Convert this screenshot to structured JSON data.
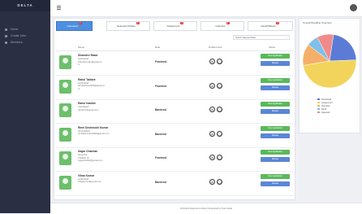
{
  "app": {
    "brand": "DELTA"
  },
  "sidebar": {
    "items": [
      {
        "label": "Home"
      },
      {
        "label": "Create Jobs"
      },
      {
        "label": "Members"
      }
    ]
  },
  "tabs": [
    {
      "label": "Interested",
      "badge": "7"
    },
    {
      "label": "Selected Profiles",
      "badge": "4"
    },
    {
      "label": "Assignment",
      "badge": "3"
    },
    {
      "label": "Interview",
      "badge": "6"
    },
    {
      "label": "Hired/Offered",
      "badge": "2"
    }
  ],
  "filter": {
    "placeholder": "Search Selected Roles"
  },
  "table": {
    "headers": [
      "Name",
      "Role",
      "Profile Links",
      "Action"
    ],
    "rows": [
      {
        "name": "Shamdev Rawa",
        "lines": [
          "Hyderabad",
          "shamdevr.dev@gmail.co",
          "m"
        ],
        "role": "Frontend"
      },
      {
        "name": "Rahul Tathare",
        "lines": [
          "Hyderabad",
          "rahultathare2009@gmail.co",
          "m"
        ],
        "role": "Frontend"
      },
      {
        "name": "Rahul Kamble",
        "lines": [
          "Chandigarh",
          "rahulk17@gmail.com"
        ],
        "role": "Backend"
      },
      {
        "name": "Rinni Deshmukh Kumar",
        "lines": [
          "Ahmedabad",
          "rinnideshmukh2000@gmail.com"
        ],
        "role": "Backend"
      },
      {
        "name": "Sagar Chauhan",
        "lines": [
          "Himachal",
          "Pradesh 10",
          "sagarch2022@gmail.com"
        ],
        "role": "Frontend"
      },
      {
        "name": "Vihas Kumar",
        "lines": [
          "Hyderabad",
          "vihaskumar@gmail.com"
        ],
        "role": "Backend"
      }
    ],
    "action_primary": "View Application",
    "action_secondary": "Review"
  },
  "side": {
    "title": "Overall Roadline Overview",
    "legend": [
      "Shortlisted",
      "Assignment",
      "Interview",
      "Hired",
      "Rejected"
    ]
  },
  "chart_data": {
    "type": "pie",
    "categories": [
      "Shortlisted",
      "Assignment",
      "Interview",
      "Hired",
      "Rejected"
    ],
    "values": [
      22,
      48,
      13,
      7,
      10
    ],
    "colors": [
      "#5b7bd6",
      "#f2d45c",
      "#f4b06a",
      "#7ec0ea",
      "#f08b8b"
    ]
  },
  "footer": {
    "text": "All Rights Reserved to Delta | Developed by Team Delta"
  }
}
